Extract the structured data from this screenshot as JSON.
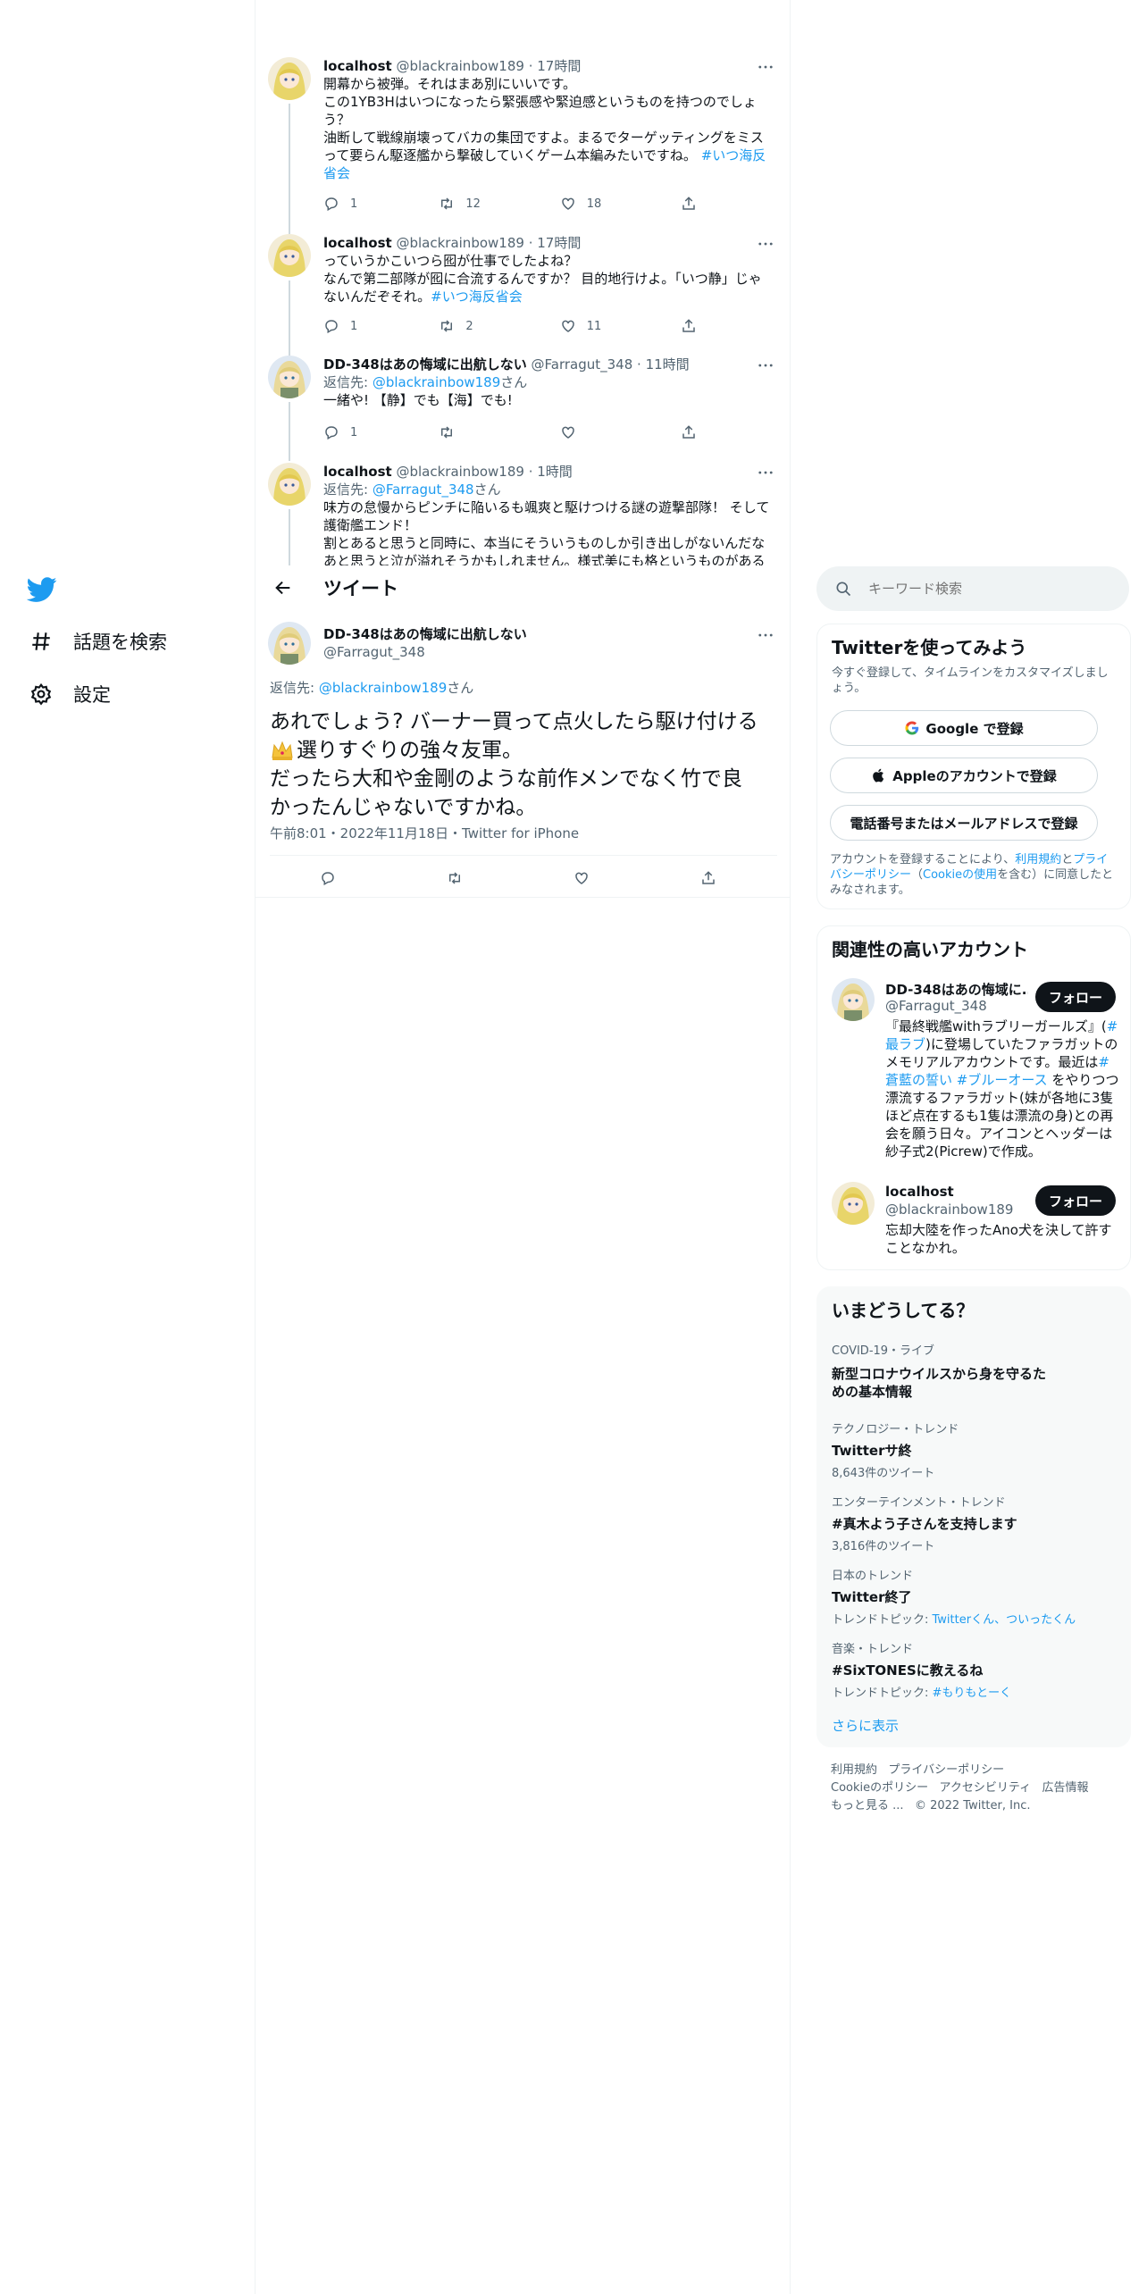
{
  "nav": {
    "items": [
      {
        "label": "話題を検索",
        "icon": "hashtag-icon"
      },
      {
        "label": "設定",
        "icon": "gear-icon"
      }
    ]
  },
  "thread": [
    {
      "name": "localhost",
      "handle": "@blackrainbow189",
      "time": "17時間",
      "lines": [
        "開幕から被弾。それはまあ別にいいです。",
        "この1YB3Hはいつになったら緊張感や緊迫感というものを持つのでしょ",
        "う？",
        "油断して戦線崩壊ってバカの集団ですよ。まるでターゲッティングをミス",
        "って要らん駆逐艦から撃破していくゲーム本編みたいですね。"
      ],
      "hashtag1": "#いつ海反",
      "hashtag2": "省会",
      "replies": "1",
      "retweets": "12",
      "likes": "18"
    },
    {
      "name": "localhost",
      "handle": "@blackrainbow189",
      "time": "17時間",
      "lines": [
        "っていうかこいつら囮が仕事でしたよね？",
        "なんで第二部隊が囮に合流するんですか？ 目的地行けよ。「いつ静」じゃ",
        "ないんだぞそれ。"
      ],
      "hashtag1": "#いつ海反省会",
      "replies": "1",
      "retweets": "2",
      "likes": "11"
    },
    {
      "name": "DD-348はあの悔域に出航しない",
      "handle": "@Farragut_348",
      "time": "11時間",
      "reply_prefix": "返信先: ",
      "reply_to": "@blackrainbow189",
      "reply_suffix": "さん",
      "lines": [
        "一緒や! 【静】でも【海】でも!"
      ],
      "replies": "1"
    },
    {
      "name": "localhost",
      "handle": "@blackrainbow189",
      "time": "1時間",
      "reply_prefix": "返信先: ",
      "reply_to": "@Farragut_348",
      "reply_suffix": "さん",
      "lines": [
        "味方の怠慢からピンチに陥いるも颯爽と駆けつける謎の遊撃部隊！ そして",
        "護衛艦エンド！",
        "割とあると思うと同時に、本当にそういうものしか引き出しがないんだな",
        "あと思うと泣が溢れそうかもしれません。様式美にも格というものがある"
      ]
    }
  ],
  "header": {
    "title": "ツイート"
  },
  "main_tweet": {
    "name": "DD-348はあの悔域に出航しない",
    "handle": "@Farragut_348",
    "reply_prefix": "返信先: ",
    "reply_to": "@blackrainbow189",
    "reply_suffix": "さん",
    "line1": "あれでしょう? バーナー買って点火したら駆け付ける",
    "line2": "選りすぐりの強々友軍。",
    "line3": "だったら大和や金剛のような前作メンでなく竹で良",
    "line4": "かったんじゃないですかね。",
    "meta": "午前8:01・2022年11月18日・Twitter for iPhone"
  },
  "search": {
    "placeholder": "キーワード検索"
  },
  "signup": {
    "title": "Twitterを使ってみよう",
    "subtitle": "今すぐ登録して、タイムラインをカスタマイズしましょう。",
    "google": "Google で登録",
    "apple": "Appleのアカウントで登録",
    "phone": "電話番号またはメールアドレスで登録",
    "legal_1": "アカウントを登録することにより、",
    "legal_terms": "利用規約",
    "legal_2": "と",
    "legal_privacy": "プライバシーポリシー",
    "legal_3": "（",
    "legal_cookie": "Cookieの使用",
    "legal_4": "を含む）に同意したとみなされます。"
  },
  "relevant": {
    "title": "関連性の高いアカウント",
    "accounts": [
      {
        "name": "DD-348はあの悔域に...",
        "handle": "@Farragut_348",
        "follow": "フォロー",
        "bio": [
          "『最終戦艦withラブリーガールズ』(",
          "#最ラブ",
          ")に登場していたファラガット",
          "のメモリアルアカウントです。最近は",
          "#蒼藍の誓い",
          "#ブルーオース",
          "をやりつつ漂流するファラガット(妹が各地に3隻ほど点在するも1隻は漂流の身)との再会を願う日々。アイコンとヘッダーは紗子式2(Picrew)で作成。"
        ]
      },
      {
        "name": "localhost",
        "handle": "@blackrainbow189",
        "follow": "フォロー",
        "bio": [
          "忘却大陸を作ったAno犬を決して許すことなかれ。"
        ]
      }
    ]
  },
  "trends": {
    "title": "いまどうしてる？",
    "items": [
      {
        "cat": "COVID-19・ライブ",
        "name": "新型コロナウイルスから身を守るための基本情報",
        "count": ""
      },
      {
        "cat": "テクノロジー・トレンド",
        "name": "Twitterサ終",
        "count": "8,643件のツイート"
      },
      {
        "cat": "エンターテインメント・トレンド",
        "name": "#真木よう子さんを支持します",
        "count": "3,816件のツイート"
      },
      {
        "cat": "日本のトレンド",
        "name": "Twitter終了",
        "topic_label": "トレンドトピック: ",
        "topic": "Twitterくん、ついったくん"
      },
      {
        "cat": "音楽・トレンド",
        "name": "#SixTONESに教えるね",
        "topic_label": "トレンドトピック: ",
        "topic": "#もりもとーく"
      }
    ],
    "more": "さらに表示"
  },
  "footer": {
    "l1a": "利用規約",
    "l1b": "プライバシーポリシー",
    "l2a": "Cookieのポリシー",
    "l2b": "アクセシビリティ",
    "l2c": "広告情報",
    "l3a": "もっと見る ...",
    "l3b": "© 2022 Twitter, Inc."
  },
  "colors": {
    "accent": "#1d9bf0",
    "text": "#0f1419",
    "muted": "#536471",
    "border": "#eff3f4"
  }
}
